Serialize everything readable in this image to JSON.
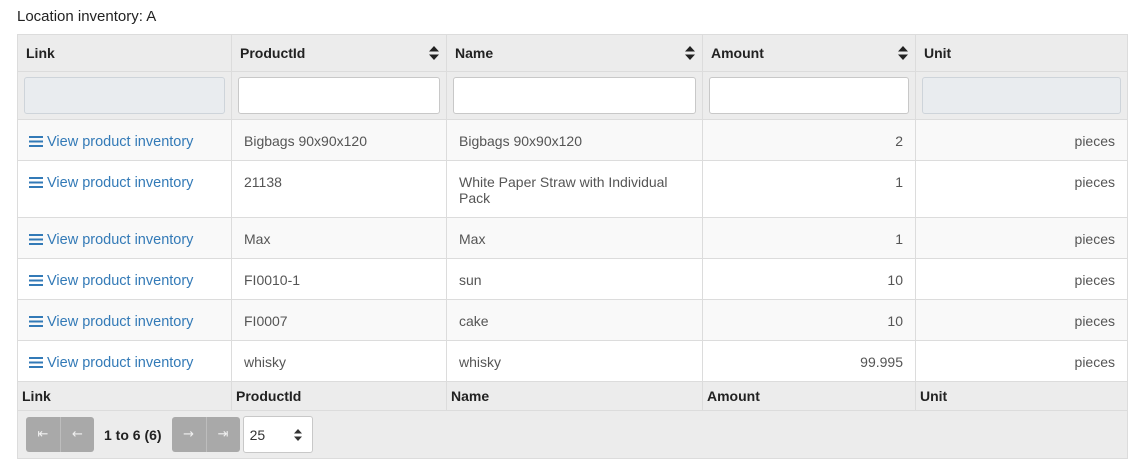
{
  "title": "Location inventory: A",
  "columns": [
    "Link",
    "ProductId",
    "Name",
    "Amount",
    "Unit"
  ],
  "link_label": "View product inventory",
  "rows": [
    {
      "productid": "Bigbags 90x90x120",
      "name": "Bigbags 90x90x120",
      "amount": "2",
      "unit": "pieces"
    },
    {
      "productid": "21138",
      "name": "White Paper Straw with Individual Pack",
      "amount": "1",
      "unit": "pieces"
    },
    {
      "productid": "Max",
      "name": "Max",
      "amount": "1",
      "unit": "pieces"
    },
    {
      "productid": "FI0010-1",
      "name": "sun",
      "amount": "10",
      "unit": "pieces"
    },
    {
      "productid": "FI0007",
      "name": "cake",
      "amount": "10",
      "unit": "pieces"
    },
    {
      "productid": "whisky",
      "name": "whisky",
      "amount": "99.995",
      "unit": "pieces"
    }
  ],
  "pager": {
    "first": "⇤",
    "prev": "←",
    "next": "→",
    "last": "⇥",
    "info": "1 to 6 (6)",
    "page_size": "25"
  },
  "colors": {
    "link": "#337ab7",
    "header_bg": "#ececec",
    "pager_btn": "#a9a9a9"
  }
}
